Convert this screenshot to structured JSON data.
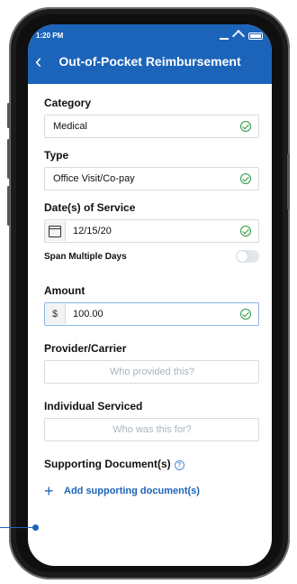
{
  "status_bar": {
    "time": "1:20 PM"
  },
  "header": {
    "title": "Out-of-Pocket Reimbursement"
  },
  "form": {
    "category": {
      "label": "Category",
      "value": "Medical"
    },
    "type": {
      "label": "Type",
      "value": "Office Visit/Co-pay"
    },
    "dates": {
      "label": "Date(s) of Service",
      "value": "12/15/20"
    },
    "span": {
      "label": "Span Multiple Days",
      "enabled": false
    },
    "amount": {
      "label": "Amount",
      "prefix": "$",
      "value": "100.00"
    },
    "provider": {
      "label": "Provider/Carrier",
      "placeholder": "Who provided this?"
    },
    "individual": {
      "label": "Individual Serviced",
      "placeholder": "Who was this for?"
    },
    "documents": {
      "label": "Supporting Document(s)",
      "add_label": "Add supporting document(s)"
    }
  },
  "colors": {
    "brand": "#1c64b9",
    "success": "#2b9a3f"
  }
}
